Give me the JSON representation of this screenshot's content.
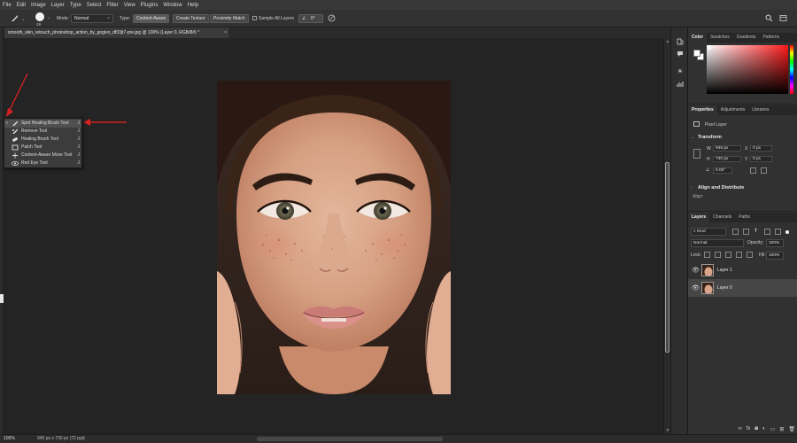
{
  "menu": [
    "File",
    "Edit",
    "Image",
    "Layer",
    "Type",
    "Select",
    "Filter",
    "View",
    "Plugins",
    "Window",
    "Help"
  ],
  "options": {
    "brush_size": "19",
    "mode_label": "Mode:",
    "mode_value": "Normal",
    "type_label": "Type:",
    "type_buttons": [
      "Content-Aware",
      "Create Texture",
      "Proximity Match"
    ],
    "sample_all_layers": "Sample All Layers",
    "angle_value": "0°"
  },
  "document": {
    "tab_title": "smooth_skin_retouch_photoshop_action_by_gogivo_df33jt7-pre.jpg @ 100% (Layer 0, RGB/8#) *",
    "close_glyph": "×"
  },
  "tool_flyout": {
    "items": [
      {
        "label": "Spot Healing Brush Tool",
        "key": "J",
        "selected": true
      },
      {
        "label": "Remove Tool",
        "key": "J",
        "selected": false
      },
      {
        "label": "Healing Brush Tool",
        "key": "J",
        "selected": false
      },
      {
        "label": "Patch Tool",
        "key": "J",
        "selected": false
      },
      {
        "label": "Content-Aware Move Tool",
        "key": "J",
        "selected": false
      },
      {
        "label": "Red Eye Tool",
        "key": "J",
        "selected": false
      }
    ]
  },
  "status": {
    "zoom": "100%",
    "dimensions": "945 px x 730 px (72 ppi)"
  },
  "color_panel": {
    "tabs": [
      "Color",
      "Swatches",
      "Gradients",
      "Patterns"
    ],
    "active_tab": "Color",
    "foreground": "#ffffff",
    "background": "#ffffff"
  },
  "properties_panel": {
    "tabs": [
      "Properties",
      "Adjustments",
      "Libraries"
    ],
    "layer_type": "Pixel Layer",
    "transform_label": "Transform",
    "w_label": "W",
    "w_value": "945 px",
    "h_label": "H",
    "h_value": "730 px",
    "x_label": "X",
    "x_value": "0 px",
    "y_label": "Y",
    "y_value": "0 px",
    "angle_value": "0.00°",
    "align_label": "Align and Distribute",
    "align_sub": "Align:"
  },
  "layers_panel": {
    "tabs": [
      "Layers",
      "Channels",
      "Paths"
    ],
    "kind_label": "Kind",
    "blend_mode": "Normal",
    "opacity_label": "Opacity:",
    "opacity_value": "100%",
    "lock_label": "Lock:",
    "fill_label": "Fill:",
    "fill_value": "100%",
    "layers": [
      {
        "name": "Layer 1",
        "selected": false
      },
      {
        "name": "Layer 0",
        "selected": true
      }
    ]
  },
  "colors": {
    "annotation_arrow": "#d42020",
    "selection_highlight": "#505050"
  }
}
